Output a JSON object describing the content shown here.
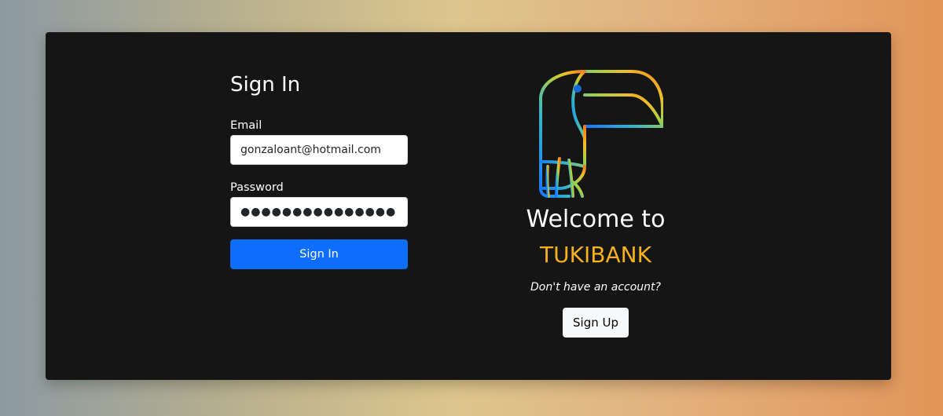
{
  "sign_in": {
    "title": "Sign In",
    "email_label": "Email",
    "email_value": "gonzaloant@hotmail.com",
    "password_label": "Password",
    "password_mask": "●●●●●●●●●●●●●●●",
    "submit_label": "Sign In"
  },
  "welcome": {
    "logo_icon": "toucan-logo-icon",
    "heading": "Welcome to",
    "brand": "TUKIBANK",
    "question": "Don't have an account?",
    "signup_label": "Sign Up"
  },
  "colors": {
    "card_background": "#151515",
    "primary_button": "#0d6efd",
    "brand_text": "#f7b119",
    "logo_gradient": [
      "#1677ff",
      "#35b6c9",
      "#a7d046",
      "#f0be27",
      "#f27a24"
    ]
  }
}
